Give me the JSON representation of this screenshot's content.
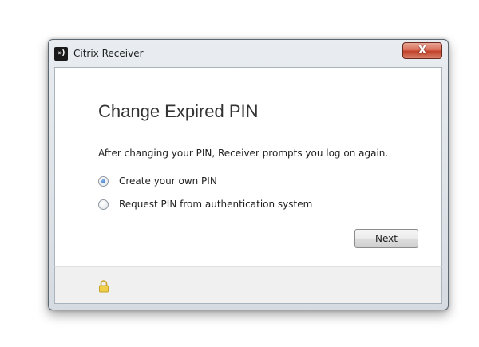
{
  "window": {
    "title": "Citrix Receiver",
    "app_icon": "citrix-receiver-icon",
    "app_icon_glyph": "»)",
    "close_glyph": "X"
  },
  "dialog": {
    "heading": "Change Expired PIN",
    "description": "After changing your PIN, Receiver prompts you log on again.",
    "options": [
      {
        "label": "Create your own PIN",
        "selected": true
      },
      {
        "label": "Request PIN from authentication system",
        "selected": false
      }
    ],
    "next_label": "Next"
  },
  "footer": {
    "icon": "lock-icon",
    "icon_color": "#e8c23a"
  },
  "colors": {
    "close_button": "#c9452f",
    "radio_selected": "#1e5fb0"
  }
}
